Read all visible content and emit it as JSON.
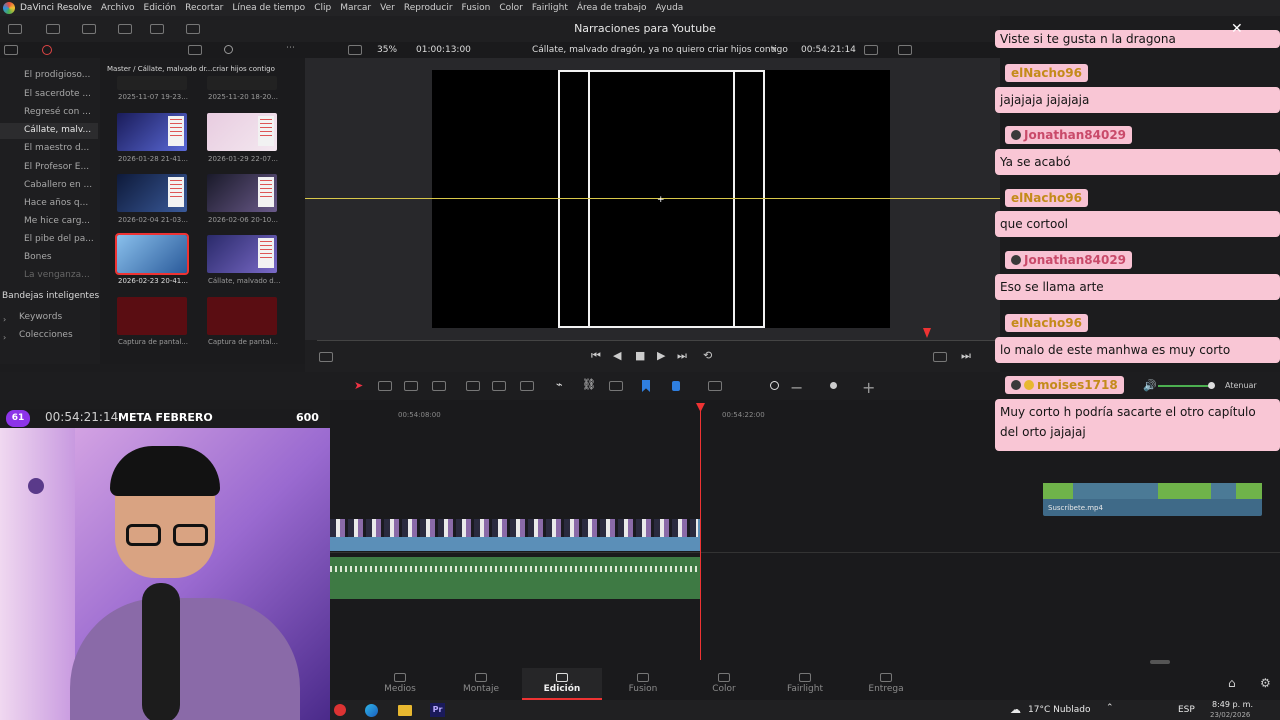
{
  "app": {
    "name": "DaVinci Resolve",
    "menus": [
      "Archivo",
      "Edición",
      "Recortar",
      "Línea de tiempo",
      "Clip",
      "Marcar",
      "Ver",
      "Reproducir",
      "Fusion",
      "Color",
      "Fairlight",
      "Área de trabajo",
      "Ayuda"
    ],
    "project_title": "Narraciones para Youtube"
  },
  "viewer": {
    "zoom": "35%",
    "source_timecode": "01:00:13:00",
    "timeline_name": "Cállate, malvado dragón, ya no quiero criar hijos contigo",
    "record_timecode": "00:54:21:14"
  },
  "media_pool": {
    "path": "Master / Cállate, malvado dr...criar hijos contigo",
    "clips": [
      {
        "label": "2025-11-07 19-23..."
      },
      {
        "label": "2025-11-20 18-20..."
      },
      {
        "label": "2026-01-28 21-41..."
      },
      {
        "label": "2026-01-29 22-07..."
      },
      {
        "label": "2026-02-04 21-03..."
      },
      {
        "label": "2026-02-06 20-10..."
      },
      {
        "label": "2026-02-23 20-41..."
      },
      {
        "label": "Cállate, malvado d..."
      },
      {
        "label": "Captura de pantal..."
      },
      {
        "label": "Captura de pantal..."
      }
    ]
  },
  "sidebar": {
    "bins": [
      "El prodigioso...",
      "El sacerdote ...",
      "Regresé con ...",
      "Cállate, malv...",
      "El maestro d...",
      "El Profesor E...",
      "Caballero en ...",
      "Hace años q...",
      "Me hice carg...",
      "El pibe del pa...",
      "Bones",
      "La venganza..."
    ],
    "active_index": 3,
    "smart_bins_title": "Bandejas inteligentes",
    "smart_bins": [
      "Keywords",
      "Colecciones"
    ]
  },
  "timeline": {
    "ruler_labels": [
      "00:54:08:00",
      "00:54:22:00"
    ],
    "subscribe_clip": "Suscríbete.mp4"
  },
  "pages": [
    "Medios",
    "Montaje",
    "Edición",
    "Fusion",
    "Color",
    "Fairlight",
    "Entrega"
  ],
  "active_page": "Edición",
  "stream_overlay": {
    "number": "61",
    "timer": "00:54:21:14",
    "goal": "META FEBRERO",
    "target": "600"
  },
  "chat": [
    {
      "user": "",
      "message": "Viste si te gusta n la dragona"
    },
    {
      "user": "elNacho96",
      "message": "jajajaja jajajaja"
    },
    {
      "user": "Jonathan84029",
      "message": "Ya se acabó"
    },
    {
      "user": "elNacho96",
      "message": "que cortool"
    },
    {
      "user": "Jonathan84029",
      "message": "Eso se llama arte"
    },
    {
      "user": "elNacho96",
      "message": "lo malo de este manhwa es muy corto"
    },
    {
      "user": "moises1718",
      "message": "Muy corto h podría sacarte el otro capítulo del orto jajajaj"
    }
  ],
  "audio": {
    "mute_label": "Atenuar"
  },
  "taskbar": {
    "weather": "17°C Nublado",
    "language": "ESP",
    "time": "8:49 p. m.",
    "date": "23/02/2026",
    "app_badge": "Pr"
  }
}
